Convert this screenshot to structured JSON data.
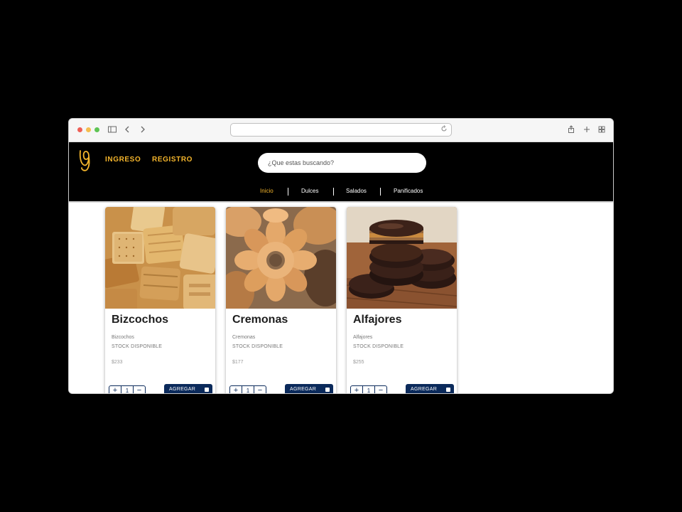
{
  "browser": {
    "icons": [
      "sidebar-icon",
      "chevron-left-icon",
      "chevron-right-icon",
      "share-icon",
      "plus-icon",
      "tabs-grid-icon",
      "reload-icon"
    ]
  },
  "header": {
    "nav": {
      "ingreso": "INGRESO",
      "registro": "REGISTRO"
    },
    "search": {
      "placeholder": "¿Que estas buscando?"
    },
    "categories": [
      "Inicio",
      "Dulces",
      "Salados",
      "Panificados"
    ],
    "active_category": "Inicio"
  },
  "products": [
    {
      "title": "Bizcochos",
      "description": "Bizcochos",
      "stock": "STOCK DISPONIBLE",
      "price": "$233",
      "quantity": "1",
      "add_label": "AGREGAR"
    },
    {
      "title": "Cremonas",
      "description": "Cremonas",
      "stock": "STOCK DISPONIBLE",
      "price": "$177",
      "quantity": "1",
      "add_label": "AGREGAR"
    },
    {
      "title": "Alfajores",
      "description": "Alfajores",
      "stock": "STOCK DISPONIBLE",
      "price": "$255",
      "quantity": "1",
      "add_label": "AGREGAR"
    }
  ],
  "qty_controls": {
    "plus": "+",
    "minus": "−"
  },
  "colors": {
    "accent": "#f4b52c",
    "primary_button": "#0b2a5b",
    "header_bg": "#000000",
    "whatsapp": "#25d366"
  }
}
